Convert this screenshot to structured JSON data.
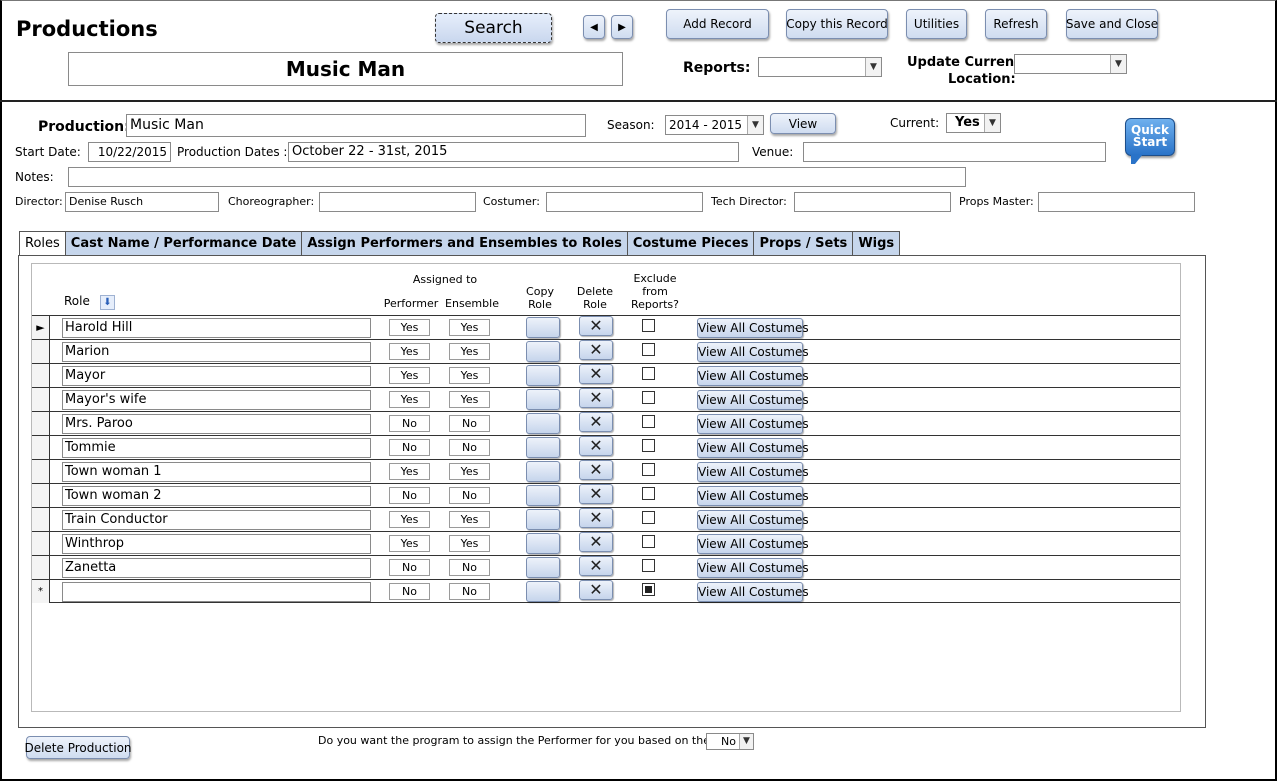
{
  "header": {
    "title": "Productions",
    "production_name": "Music Man",
    "search_label": "Search",
    "prev_icon": "triangle-left-icon",
    "next_icon": "triangle-right-icon",
    "buttons": {
      "add_record": "Add Record",
      "copy_record": "Copy this Record",
      "utilities": "Utilities",
      "refresh": "Refresh",
      "save_close": "Save and Close"
    },
    "reports_label": "Reports:",
    "reports_value": "",
    "update_location_label_1": "Update Current",
    "update_location_label_2": "Location:",
    "update_location_value": ""
  },
  "form": {
    "production_label": "Production:",
    "production_value": "Music Man",
    "season_label": "Season:",
    "season_value": "2014 - 2015",
    "view_label": "View",
    "current_label": "Current:",
    "current_value": "Yes",
    "quick_start_1": "Quick",
    "quick_start_2": "Start",
    "start_date_label": "Start Date:",
    "start_date_value": "10/22/2015",
    "production_dates_label": "Production Dates :",
    "production_dates_value": "October 22 - 31st, 2015",
    "venue_label": "Venue:",
    "venue_value": "",
    "notes_label": "Notes:",
    "notes_value": "",
    "director_label": "Director:",
    "director_value": "Denise Rusch",
    "choreographer_label": "Choreographer:",
    "choreographer_value": "",
    "costumer_label": "Costumer:",
    "costumer_value": "",
    "tech_director_label": "Tech Director:",
    "tech_director_value": "",
    "props_master_label": "Props Master:",
    "props_master_value": ""
  },
  "tabs": [
    {
      "label": "Roles"
    },
    {
      "label": "Cast Name / Performance Date"
    },
    {
      "label": "Assign Performers and Ensembles to Roles"
    },
    {
      "label": "Costume Pieces"
    },
    {
      "label": "Props / Sets"
    },
    {
      "label": "Wigs"
    }
  ],
  "roles_table": {
    "assigned_to": "Assigned to",
    "headers": {
      "role": "Role",
      "performer": "Performer",
      "ensemble": "Ensemble",
      "copy_1": "Copy",
      "copy_2": "Role",
      "delete_1": "Delete",
      "delete_2": "Role",
      "exclude_1": "Exclude",
      "exclude_2": "from",
      "exclude_3": "Reports?"
    },
    "view_all_label": "View All Costumes",
    "new_row_marker": "*",
    "current_row_marker": "►",
    "delete_glyph": "✕",
    "rows": [
      {
        "role": "Harold Hill",
        "performer": "Yes",
        "ensemble": "Yes",
        "exclude": false
      },
      {
        "role": "Marion",
        "performer": "Yes",
        "ensemble": "Yes",
        "exclude": false
      },
      {
        "role": "Mayor",
        "performer": "Yes",
        "ensemble": "Yes",
        "exclude": false
      },
      {
        "role": "Mayor's wife",
        "performer": "Yes",
        "ensemble": "Yes",
        "exclude": false
      },
      {
        "role": "Mrs. Paroo",
        "performer": "No",
        "ensemble": "No",
        "exclude": false
      },
      {
        "role": "Tommie",
        "performer": "No",
        "ensemble": "No",
        "exclude": false
      },
      {
        "role": "Town woman 1",
        "performer": "Yes",
        "ensemble": "Yes",
        "exclude": false
      },
      {
        "role": "Town woman 2",
        "performer": "No",
        "ensemble": "No",
        "exclude": false
      },
      {
        "role": "Train Conductor",
        "performer": "Yes",
        "ensemble": "Yes",
        "exclude": false
      },
      {
        "role": "Winthrop",
        "performer": "Yes",
        "ensemble": "Yes",
        "exclude": false
      },
      {
        "role": "Zanetta",
        "performer": "No",
        "ensemble": "No",
        "exclude": false
      },
      {
        "role": "",
        "performer": "No",
        "ensemble": "No",
        "exclude": true
      }
    ]
  },
  "footer": {
    "delete_production": "Delete Production",
    "assign_question": "Do you want the program to assign the Performer for you based on the Role?",
    "assign_value": "No"
  },
  "colors": {
    "tab_bg": "#c6d6ec",
    "button_gradient_top": "#eef3fb",
    "button_gradient_bottom": "#cfdcf0",
    "quick_start_blue": "#2a73c8"
  }
}
